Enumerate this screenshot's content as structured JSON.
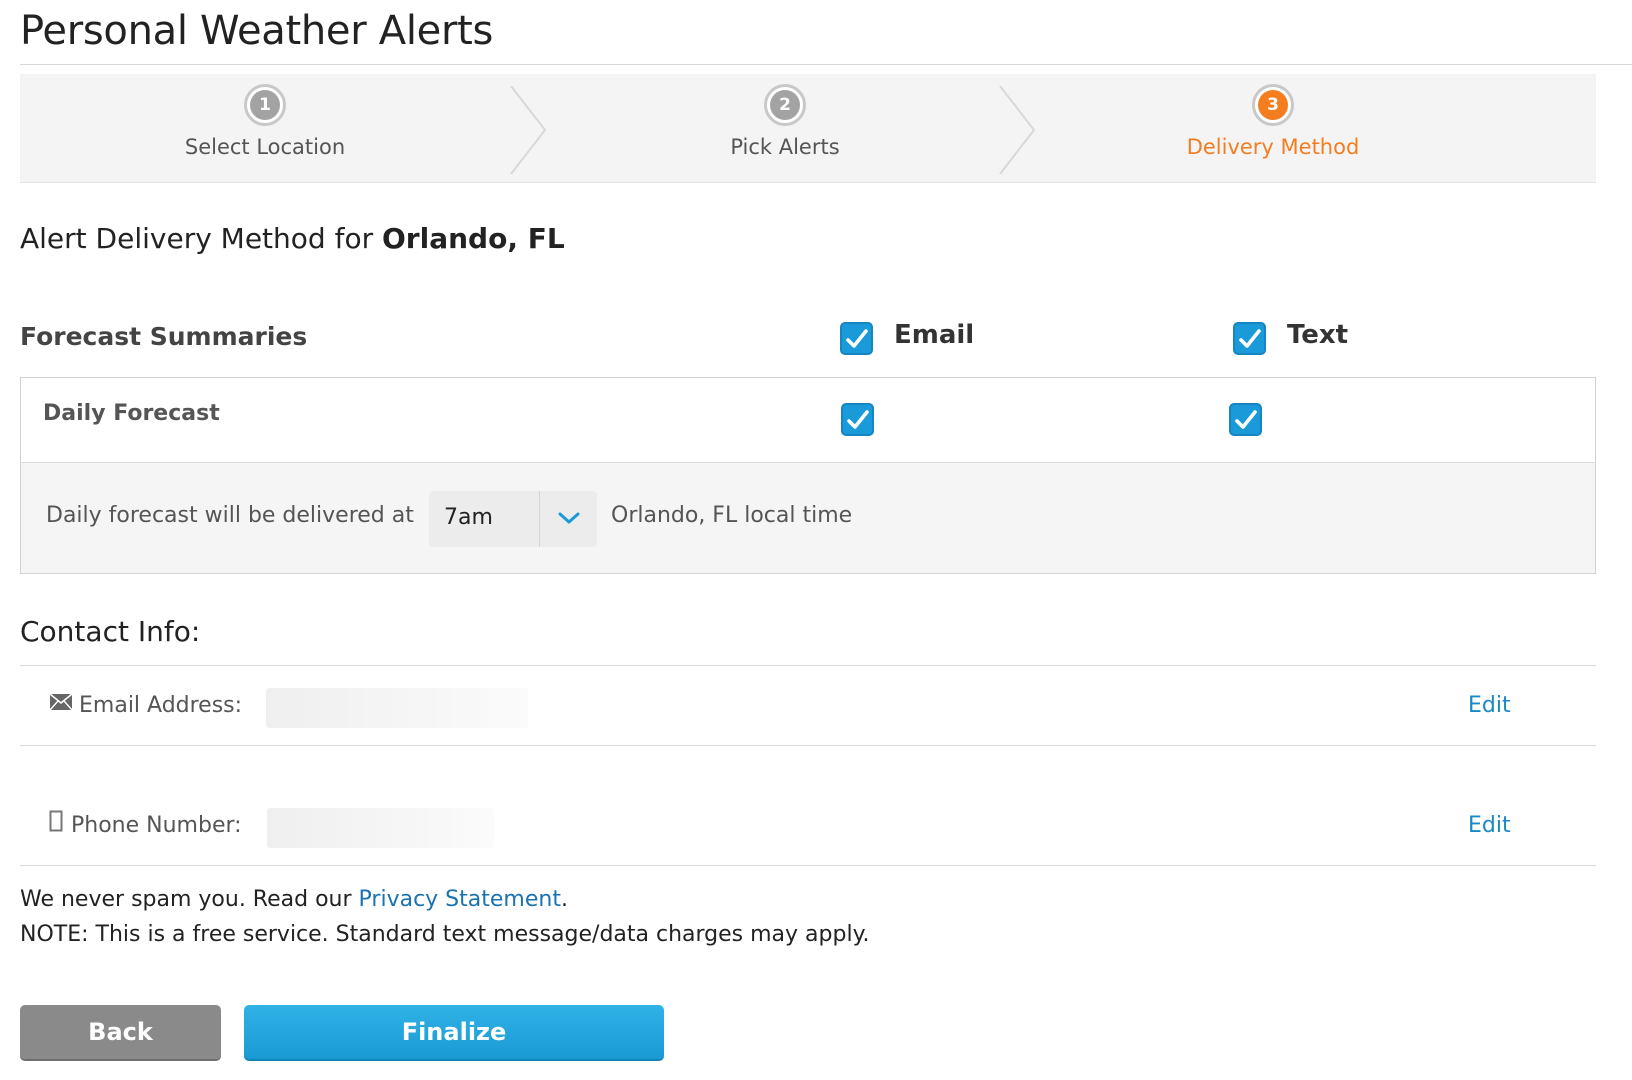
{
  "page": {
    "title": "Personal Weather Alerts"
  },
  "stepper": {
    "steps": [
      {
        "number": "1",
        "label": "Select Location",
        "state": "done"
      },
      {
        "number": "2",
        "label": "Pick Alerts",
        "state": "done"
      },
      {
        "number": "3",
        "label": "Delivery Method",
        "state": "active"
      }
    ],
    "active_color": "#f47d20"
  },
  "heading": {
    "prefix": "Alert Delivery Method for ",
    "location": "Orlando, FL"
  },
  "forecast": {
    "section_title": "Forecast Summaries",
    "columns": [
      {
        "label": "Email",
        "checked": true
      },
      {
        "label": "Text",
        "checked": true
      }
    ],
    "rows": [
      {
        "label": "Daily Forecast",
        "email_checked": true,
        "text_checked": true
      }
    ],
    "delivery_prefix": "Daily forecast will be delivered at",
    "delivery_time": "7am",
    "delivery_suffix": "Orlando, FL local time"
  },
  "contact": {
    "title": "Contact Info:",
    "email_label": "Email Address:",
    "email_edit": "Edit",
    "phone_label": "Phone Number:",
    "phone_edit": "Edit",
    "email_icon": "envelope-icon",
    "phone_icon": "mobile-phone-icon"
  },
  "footer": {
    "spam_prefix": "We never spam you. Read our ",
    "privacy_link": "Privacy Statement",
    "spam_suffix": ".",
    "note": "NOTE: This is a free service. Standard text message/data charges may apply."
  },
  "buttons": {
    "back": "Back",
    "finalize": "Finalize"
  },
  "colors": {
    "checkbox": "#1a9ad9",
    "link": "#1a89c6",
    "finalize": "#1a9ad3",
    "back": "#8a8a8a"
  }
}
